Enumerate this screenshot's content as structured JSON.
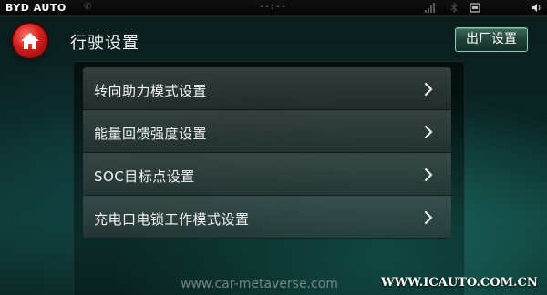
{
  "statusbar": {
    "brand": "BYD AUTO",
    "clock": "--:--",
    "icons": [
      "signal-icon",
      "usb-icon",
      "volume-icon"
    ]
  },
  "header": {
    "title": "行驶设置",
    "home_icon": "home-icon",
    "factory_button": "出厂设置"
  },
  "menu": {
    "items": [
      {
        "label": "转向助力模式设置",
        "icon": "chevron-right-icon"
      },
      {
        "label": "能量回馈强度设置",
        "icon": "chevron-right-icon"
      },
      {
        "label": "SOC目标点设置",
        "icon": "chevron-right-icon"
      },
      {
        "label": "充电口电锁工作模式设置",
        "icon": "chevron-right-icon"
      }
    ]
  },
  "watermarks": {
    "left": "www.car-metaverse.com",
    "right": "WWW.ICAUTO.COM.CN"
  },
  "colors": {
    "home_button": "#d11d1d",
    "factory_border": "#7fd0b0",
    "background": "#0f3a36"
  }
}
